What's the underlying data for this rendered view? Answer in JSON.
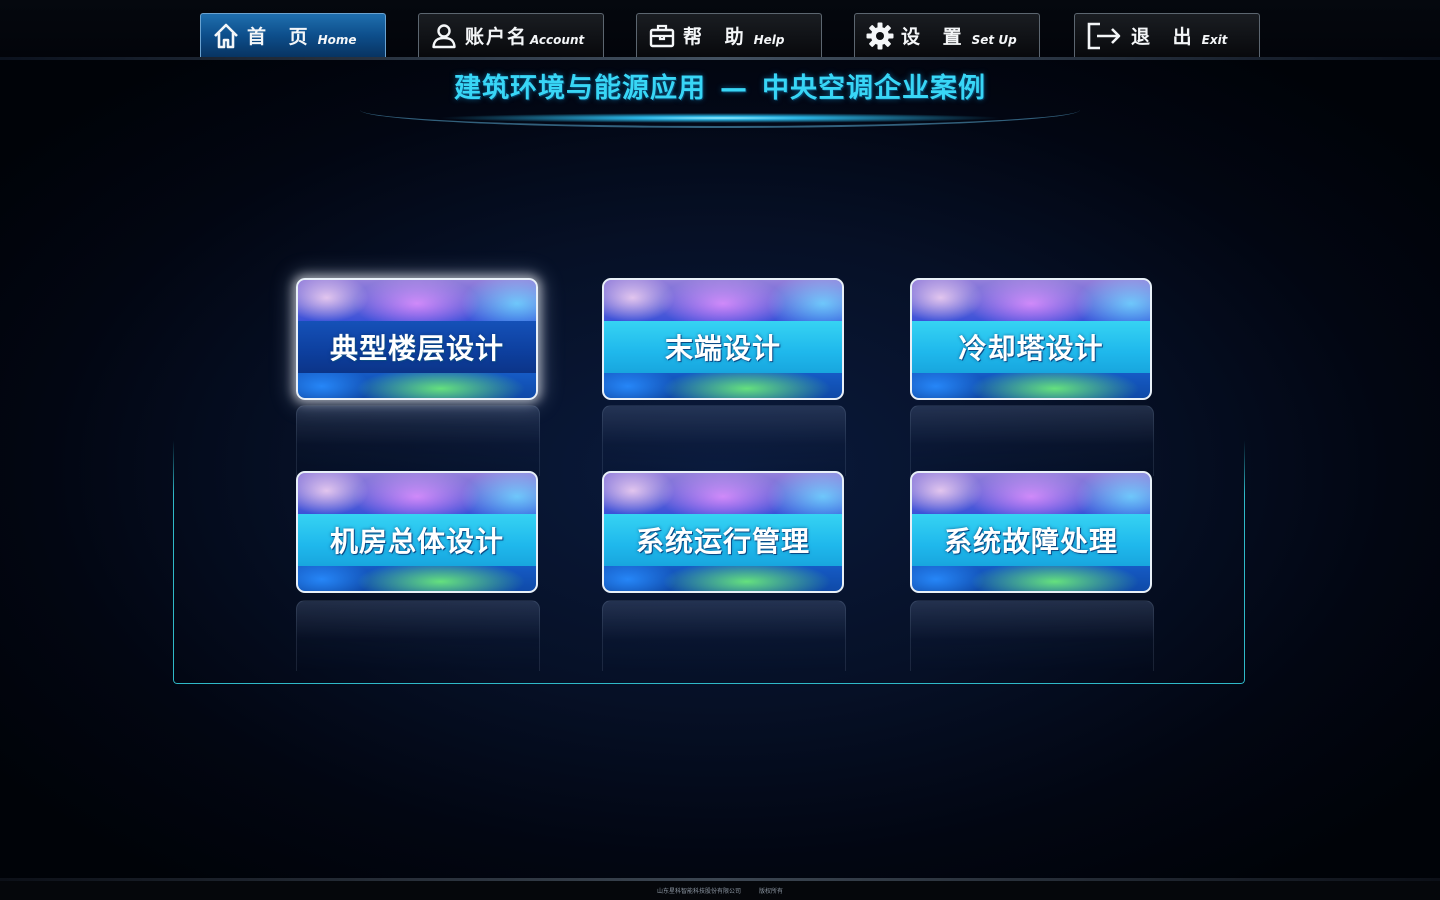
{
  "nav": {
    "tabs": [
      {
        "cn": "首 页",
        "en": "Home",
        "icon": "home-icon",
        "active": true
      },
      {
        "cn": "账户名",
        "en": "Account",
        "icon": "user-icon",
        "active": false
      },
      {
        "cn": "帮 助",
        "en": "Help",
        "icon": "briefcase-icon",
        "active": false
      },
      {
        "cn": "设 置",
        "en": "Set Up",
        "icon": "gear-icon",
        "active": false
      },
      {
        "cn": "退 出",
        "en": "Exit",
        "icon": "logout-icon",
        "active": false
      }
    ]
  },
  "header": {
    "title_left": "建筑环境与能源应用",
    "title_dash": "—",
    "title_right": "中央空调企业案例"
  },
  "tiles": [
    {
      "label": "典型楼层设计",
      "selected": true
    },
    {
      "label": "末端设计",
      "selected": false
    },
    {
      "label": "冷却塔设计",
      "selected": false
    },
    {
      "label": "机房总体设计",
      "selected": false
    },
    {
      "label": "系统运行管理",
      "selected": false
    },
    {
      "label": "系统故障处理",
      "selected": false
    }
  ],
  "footer": {
    "company": "山东星科智能科技股份有限公司",
    "rights": "版权所有"
  },
  "colors": {
    "title": "#38d6f6",
    "active_tab": "#0d4e8b",
    "tile_band": "#1fb8ec",
    "tile_band_selected": "#0d3f9e",
    "panel_border": "#2fb9c8"
  }
}
